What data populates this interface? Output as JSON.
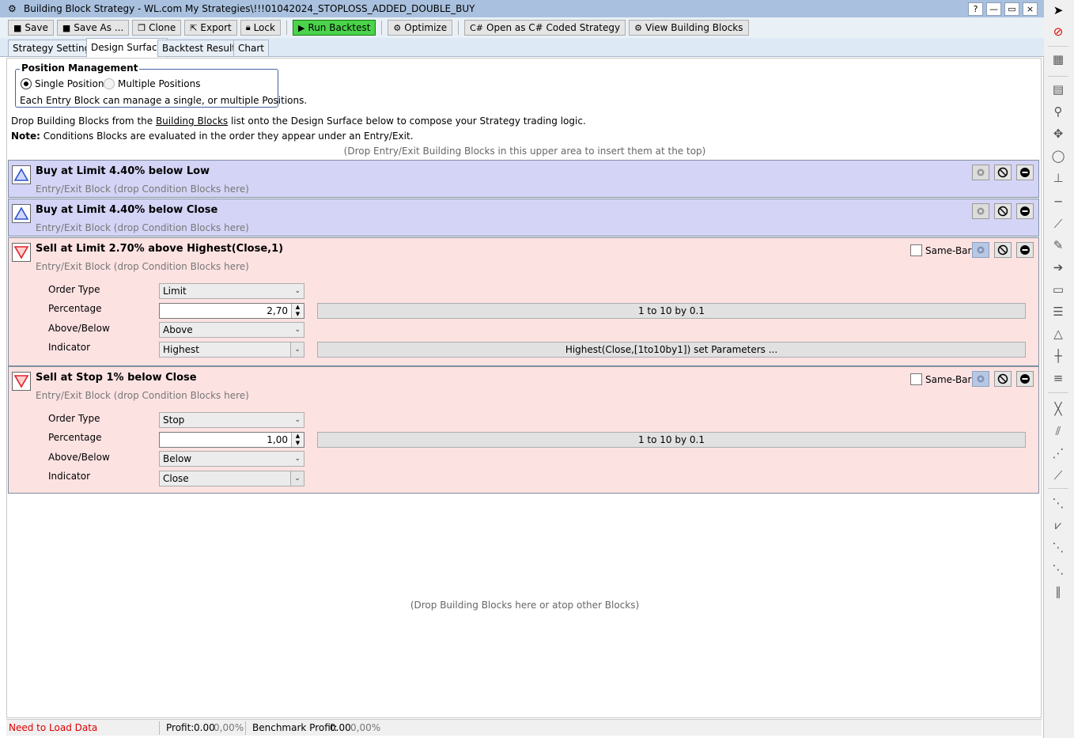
{
  "window": {
    "title": "Building Block Strategy - WL.com My Strategies\\!!!01042024_STOPLOSS_ADDED_DOUBLE_BUY",
    "buttons": [
      "?",
      "—",
      "▭",
      "×"
    ]
  },
  "toolbar": {
    "save": "Save",
    "save_as": "Save As ...",
    "clone": "Clone",
    "export": "Export",
    "lock": "Lock",
    "run_backtest": "Run Backtest",
    "optimize": "Optimize",
    "open_csharp": "Open as C# Coded Strategy",
    "view_blocks": "View Building Blocks"
  },
  "tabs": [
    "Strategy Settings",
    "Design Surface",
    "Backtest Results",
    "Chart"
  ],
  "position_management": {
    "title": "Position Management",
    "single": "Single Position",
    "multiple": "Multiple Positions",
    "description": "Each Entry Block can manage a single, or multiple Positions."
  },
  "info": {
    "line1_pre": "Drop Building Blocks from the ",
    "line1_link": "Building Blocks",
    "line1_post": " list onto the Design Surface below to compose your Strategy trading logic.",
    "note_label": "Note:",
    "note_text": " Conditions Blocks are evaluated in the order they appear under an Entry/Exit.",
    "drop_top": "(Drop Entry/Exit Building Blocks in this upper area to insert them at the top)",
    "drop_bottom": "(Drop Building Blocks here or atop other Blocks)"
  },
  "blocks": [
    {
      "title": "Buy at Limit 4.40% below Low",
      "subtitle": "Entry/Exit Block (drop Condition Blocks here)"
    },
    {
      "title": "Buy at Limit 4.40% below Close",
      "subtitle": "Entry/Exit Block (drop Condition Blocks here)"
    },
    {
      "title": "Sell at Limit 2.70% above Highest(Close,1)",
      "subtitle": "Entry/Exit Block (drop Condition Blocks here)",
      "same_bar": "Same-Bar",
      "params": {
        "order_type_label": "Order Type",
        "order_type": "Limit",
        "percentage_label": "Percentage",
        "percentage": "2,70",
        "percentage_range": "1 to 10 by 0.1",
        "above_below_label": "Above/Below",
        "above_below": "Above",
        "indicator_label": "Indicator",
        "indicator": "Highest",
        "indicator_params": "Highest(Close,[1to10by1]) set Parameters ..."
      }
    },
    {
      "title": "Sell at Stop 1% below Close",
      "subtitle": "Entry/Exit Block (drop Condition Blocks here)",
      "same_bar": "Same-Bar",
      "params": {
        "order_type_label": "Order Type",
        "order_type": "Stop",
        "percentage_label": "Percentage",
        "percentage": "1,00",
        "percentage_range": "1 to 10 by 0.1",
        "above_below_label": "Above/Below",
        "above_below": "Below",
        "indicator_label": "Indicator",
        "indicator": "Close"
      }
    }
  ],
  "status": {
    "load": "Need to Load Data",
    "profit_label": "Profit:",
    "profit_value": "0.00",
    "profit_pct": "0,00%",
    "bench_label": "Benchmark Profit:",
    "bench_value": "0.00",
    "bench_pct": "0,00%"
  },
  "colors": {
    "buy_block": "#d4d4f6",
    "sell_block": "#fde2e2",
    "run_button": "#4bd44b",
    "title_bar": "#a9c1de"
  }
}
